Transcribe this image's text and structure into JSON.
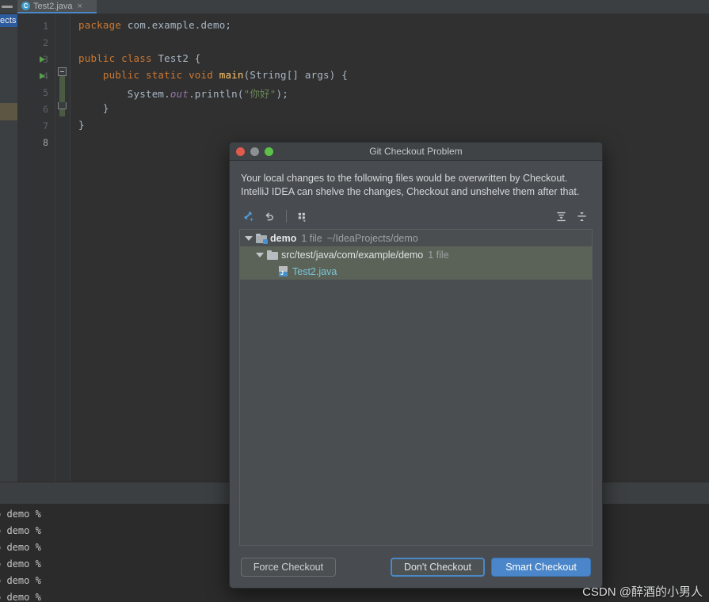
{
  "ide": {
    "tool_stripe_label": "ects",
    "tab": {
      "icon": "java-class-icon",
      "label": "Test2.java",
      "close": "×"
    },
    "editor": {
      "line_numbers": [
        "1",
        "2",
        "3",
        "4",
        "5",
        "6",
        "7",
        "8"
      ],
      "current_line": "8",
      "run_markers": [
        "3",
        "4"
      ],
      "code": [
        {
          "n": 1,
          "tokens": [
            {
              "t": "package ",
              "c": "kw"
            },
            {
              "t": "com.example.demo;",
              "c": "pun"
            }
          ]
        },
        {
          "n": 2,
          "tokens": []
        },
        {
          "n": 3,
          "tokens": [
            {
              "t": "public ",
              "c": "kw"
            },
            {
              "t": "class ",
              "c": "kw"
            },
            {
              "t": "Test2 {",
              "c": "cls"
            }
          ]
        },
        {
          "n": 4,
          "tokens": [
            {
              "t": "    public ",
              "c": "kw"
            },
            {
              "t": "static ",
              "c": "kw"
            },
            {
              "t": "void ",
              "c": "kw"
            },
            {
              "t": "main",
              "c": "fn"
            },
            {
              "t": "(String[] args) {",
              "c": "pun"
            }
          ]
        },
        {
          "n": 5,
          "tokens": [
            {
              "t": "        System.",
              "c": "pun"
            },
            {
              "t": "out",
              "c": "fld"
            },
            {
              "t": ".println(",
              "c": "pun"
            },
            {
              "t": "\"你好\"",
              "c": "str"
            },
            {
              "t": ");",
              "c": "pun"
            }
          ]
        },
        {
          "n": 6,
          "tokens": [
            {
              "t": "    }",
              "c": "pun"
            }
          ]
        },
        {
          "n": 7,
          "tokens": [
            {
              "t": "}",
              "c": "pun"
            }
          ]
        },
        {
          "n": 8,
          "tokens": []
        }
      ]
    },
    "terminal": {
      "lines": [
        "o demo %",
        "o demo %",
        "o demo %",
        "o demo %",
        "o demo %",
        "o demo %"
      ]
    }
  },
  "dialog": {
    "title": "Git Checkout Problem",
    "window_controls": {
      "close": "close-button",
      "minimize": "minimize-button",
      "zoom": "zoom-button"
    },
    "message_line1": "Your local changes to the following files would be overwritten by Checkout.",
    "message_line2": "IntelliJ IDEA can shelve the changes, Checkout and unshelve them after that.",
    "toolbar": {
      "shelve_label": "shelve-silently-icon",
      "revert_label": "revert-icon",
      "group_by_label": "group-by-icon",
      "expand_all_label": "expand-all-icon",
      "collapse_all_label": "collapse-all-icon"
    },
    "tree": {
      "nodes": [
        {
          "id": "module",
          "level": 1,
          "expanded": true,
          "icon": "module-folder-icon",
          "name": "demo",
          "count": "1 file",
          "path": "~/IdeaProjects/demo",
          "selected": false
        },
        {
          "id": "directory",
          "level": 2,
          "expanded": true,
          "icon": "folder-icon",
          "name": "src/test/java/com/example/demo",
          "count": "1 file",
          "path": "",
          "selected": true
        },
        {
          "id": "file",
          "level": 3,
          "expanded": null,
          "icon": "java-file-icon",
          "name": "Test2.java",
          "count": "",
          "path": "",
          "selected": true
        }
      ]
    },
    "buttons": {
      "force_checkout": "Force Checkout",
      "dont_checkout": "Don't Checkout",
      "smart_checkout": "Smart Checkout"
    }
  },
  "watermark": "CSDN @醉酒的小男人",
  "colors": {
    "editor_bg": "#303030",
    "gutter_bg": "#313335",
    "ide_chrome": "#3c3f41",
    "dialog_bg": "#484c50",
    "dialog_title_bg": "#3f4346",
    "tree_bg": "#4a4e51",
    "tree_selection": "#5b6359",
    "accent_blue": "#4a86c9",
    "focus_blue": "#4a88c7",
    "keyword_orange": "#cc7832",
    "string_green": "#6a8759",
    "method_yellow": "#ffc66d",
    "field_purple": "#9876aa",
    "text_default": "#a9b7c6",
    "java_file_cyan": "#79c5d8",
    "run_marker_green": "#5a9e4b",
    "projects_chip_blue": "#2d5c9e"
  }
}
